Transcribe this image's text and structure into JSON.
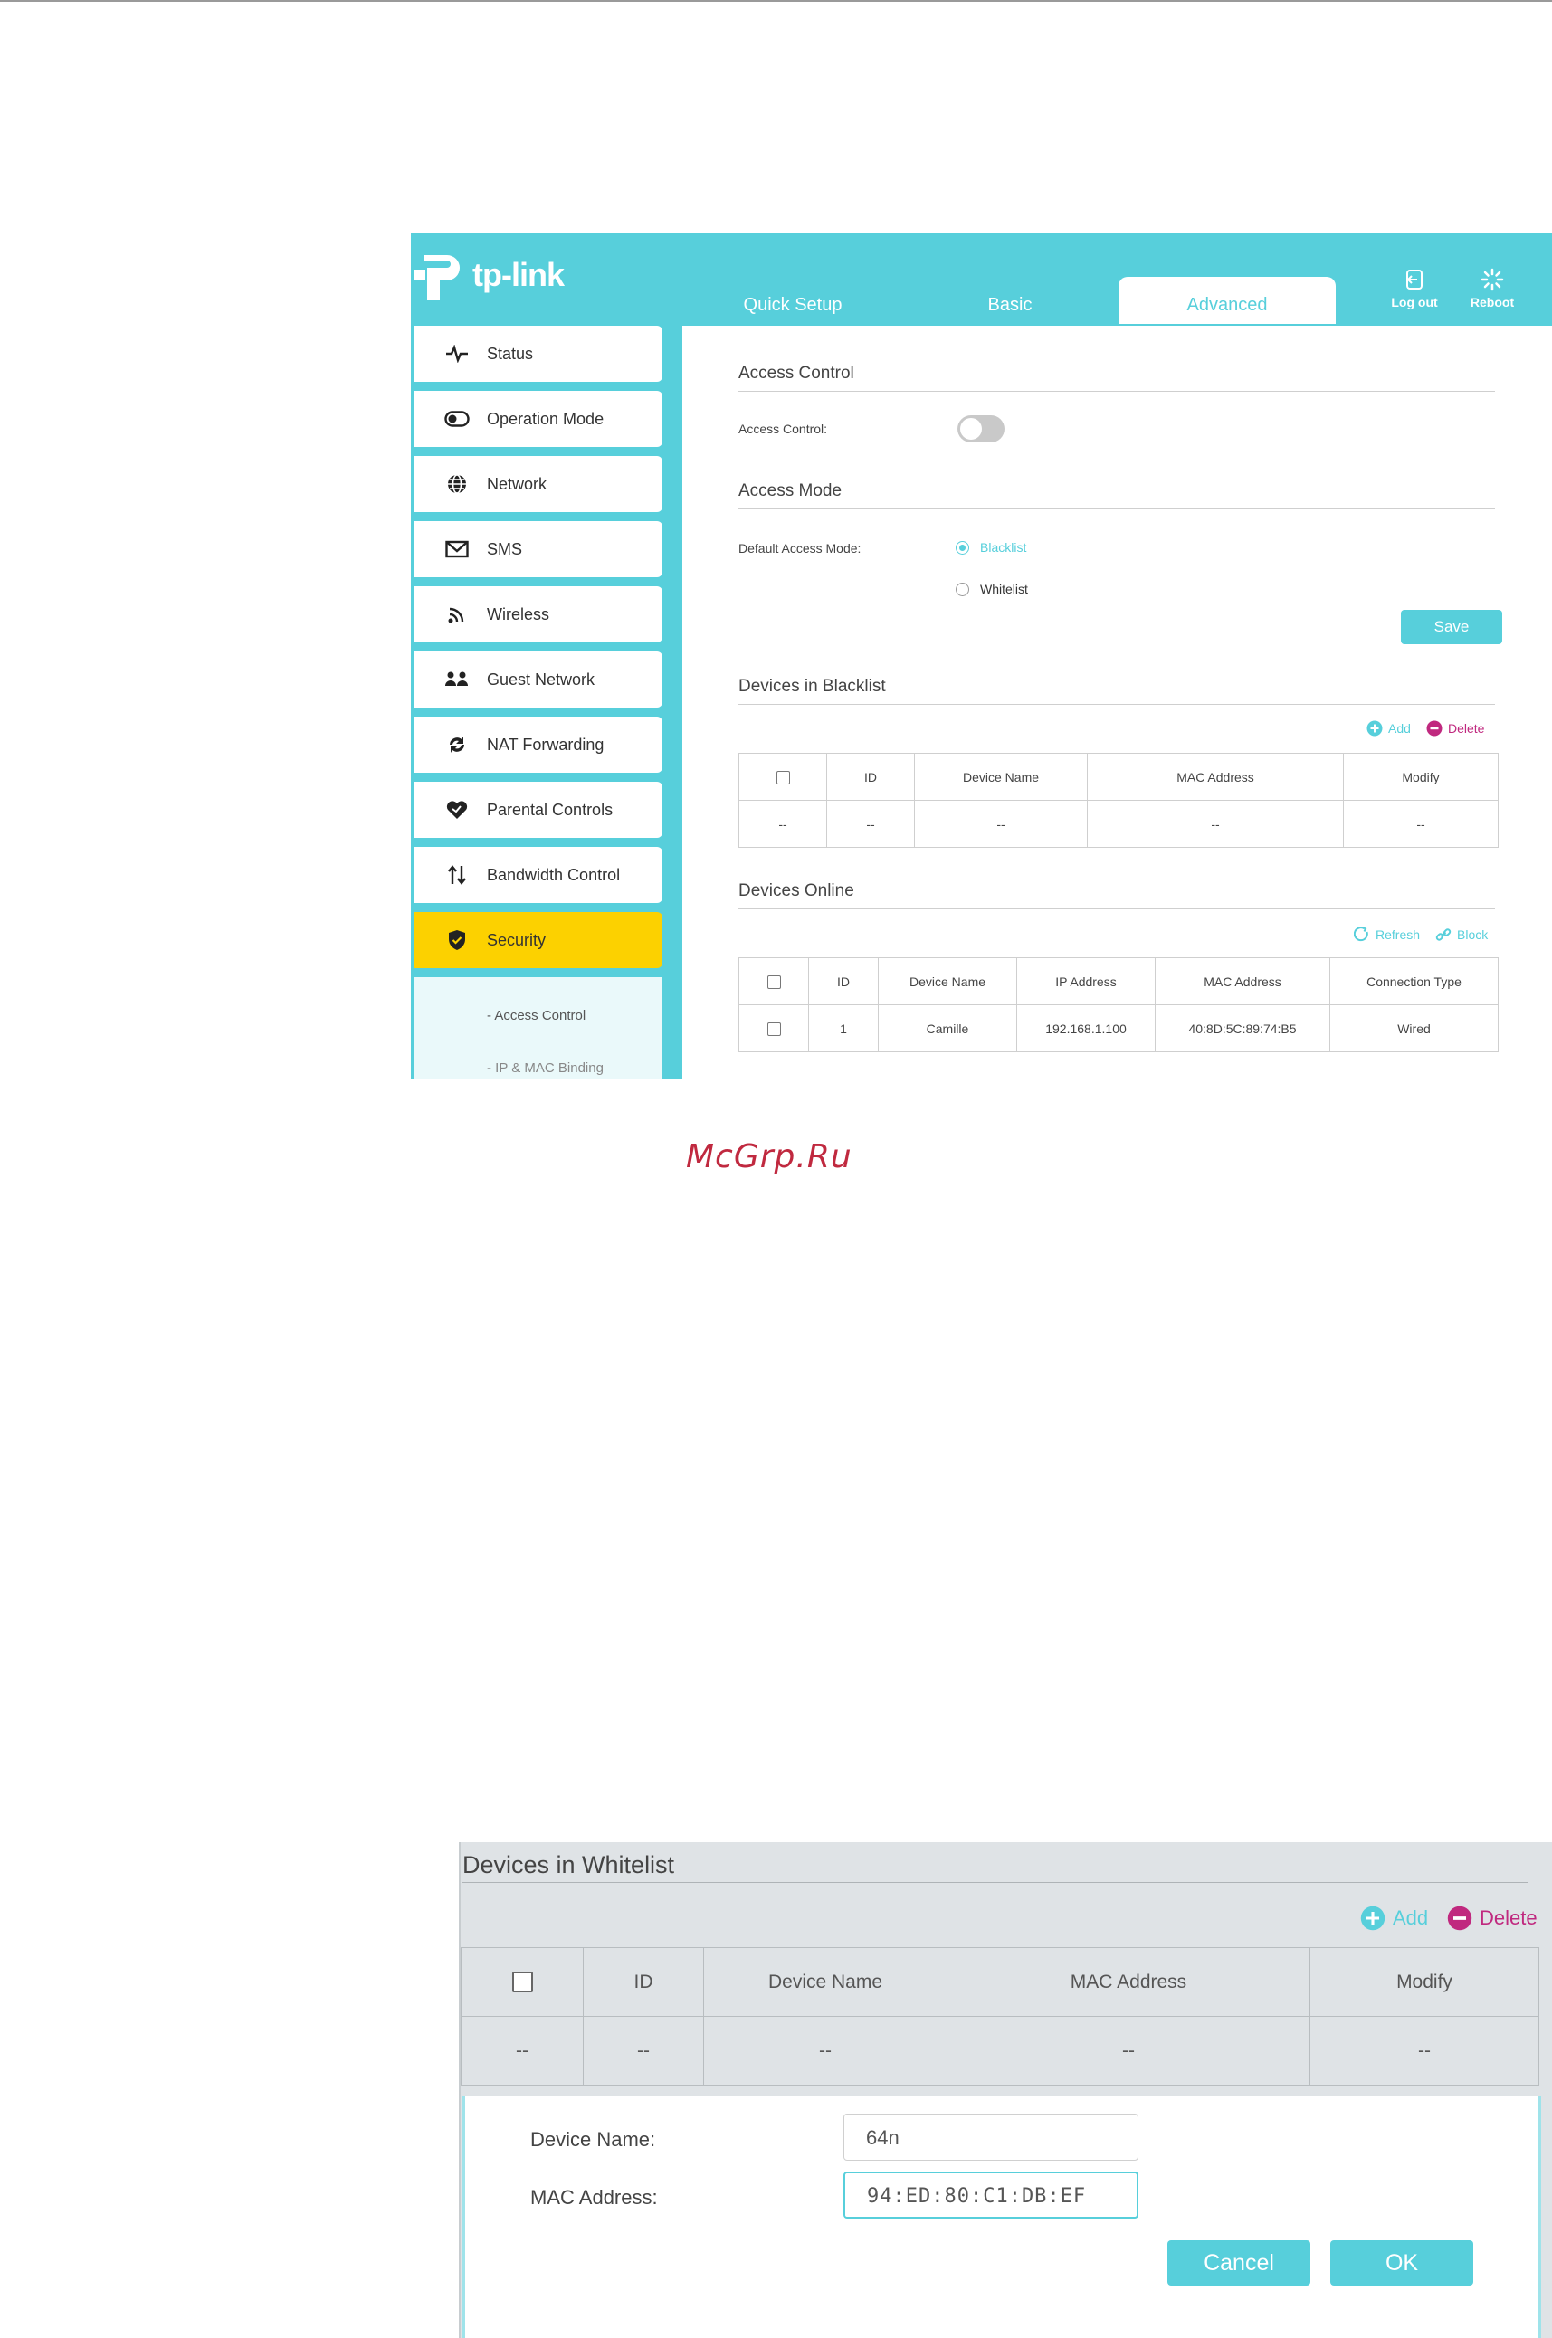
{
  "brand": {
    "name": "tp-link",
    "accent": "#57cfdb",
    "highlight": "#fcd100",
    "delete_color": "#c0297f"
  },
  "topnav": {
    "tabs": [
      "Quick Setup",
      "Basic",
      "Advanced"
    ],
    "active_tab": "Advanced",
    "logout_label": "Log out",
    "reboot_label": "Reboot"
  },
  "sidebar": {
    "items": [
      {
        "label": "Status",
        "icon": "pulse-icon"
      },
      {
        "label": "Operation Mode",
        "icon": "toggle-icon"
      },
      {
        "label": "Network",
        "icon": "globe-icon"
      },
      {
        "label": "SMS",
        "icon": "envelope-icon"
      },
      {
        "label": "Wireless",
        "icon": "wifi-icon"
      },
      {
        "label": "Guest Network",
        "icon": "guests-icon"
      },
      {
        "label": "NAT Forwarding",
        "icon": "nat-icon"
      },
      {
        "label": "Parental Controls",
        "icon": "heart-icon"
      },
      {
        "label": "Bandwidth Control",
        "icon": "arrows-updown-icon"
      },
      {
        "label": "Security",
        "icon": "shield-icon"
      }
    ],
    "active_item": "Security",
    "subitems": [
      "- Access Control",
      "- IP & MAC Binding"
    ]
  },
  "access_control": {
    "section_title": "Access Control",
    "label": "Access Control:",
    "enabled": false
  },
  "access_mode": {
    "section_title": "Access Mode",
    "label": "Default Access Mode:",
    "options": [
      "Blacklist",
      "Whitelist"
    ],
    "selected": "Blacklist",
    "save_label": "Save"
  },
  "blacklist": {
    "section_title": "Devices in Blacklist",
    "add_label": "Add",
    "delete_label": "Delete",
    "columns": [
      "ID",
      "Device Name",
      "MAC Address",
      "Modify"
    ],
    "rows": [
      [
        "--",
        "--",
        "--",
        "--",
        "--"
      ]
    ]
  },
  "online": {
    "section_title": "Devices Online",
    "refresh_label": "Refresh",
    "block_label": "Block",
    "columns": [
      "ID",
      "Device Name",
      "IP Address",
      "MAC Address",
      "Connection Type"
    ],
    "rows": [
      [
        "1",
        "Camille",
        "192.168.1.100",
        "40:8D:5C:89:74:B5",
        "Wired"
      ]
    ]
  },
  "watermark": "McGrp.Ru",
  "whitelist": {
    "section_title": "Devices in Whitelist",
    "add_label": "Add",
    "delete_label": "Delete",
    "columns": [
      "ID",
      "Device Name",
      "MAC Address",
      "Modify"
    ],
    "rows": [
      [
        "--",
        "--",
        "--",
        "--",
        "--"
      ]
    ],
    "form": {
      "device_name_label": "Device Name:",
      "device_name_value": "64n",
      "mac_label": "MAC Address:",
      "mac_value": "94:ED:80:C1:DB:EF",
      "cancel_label": "Cancel",
      "ok_label": "OK"
    }
  }
}
